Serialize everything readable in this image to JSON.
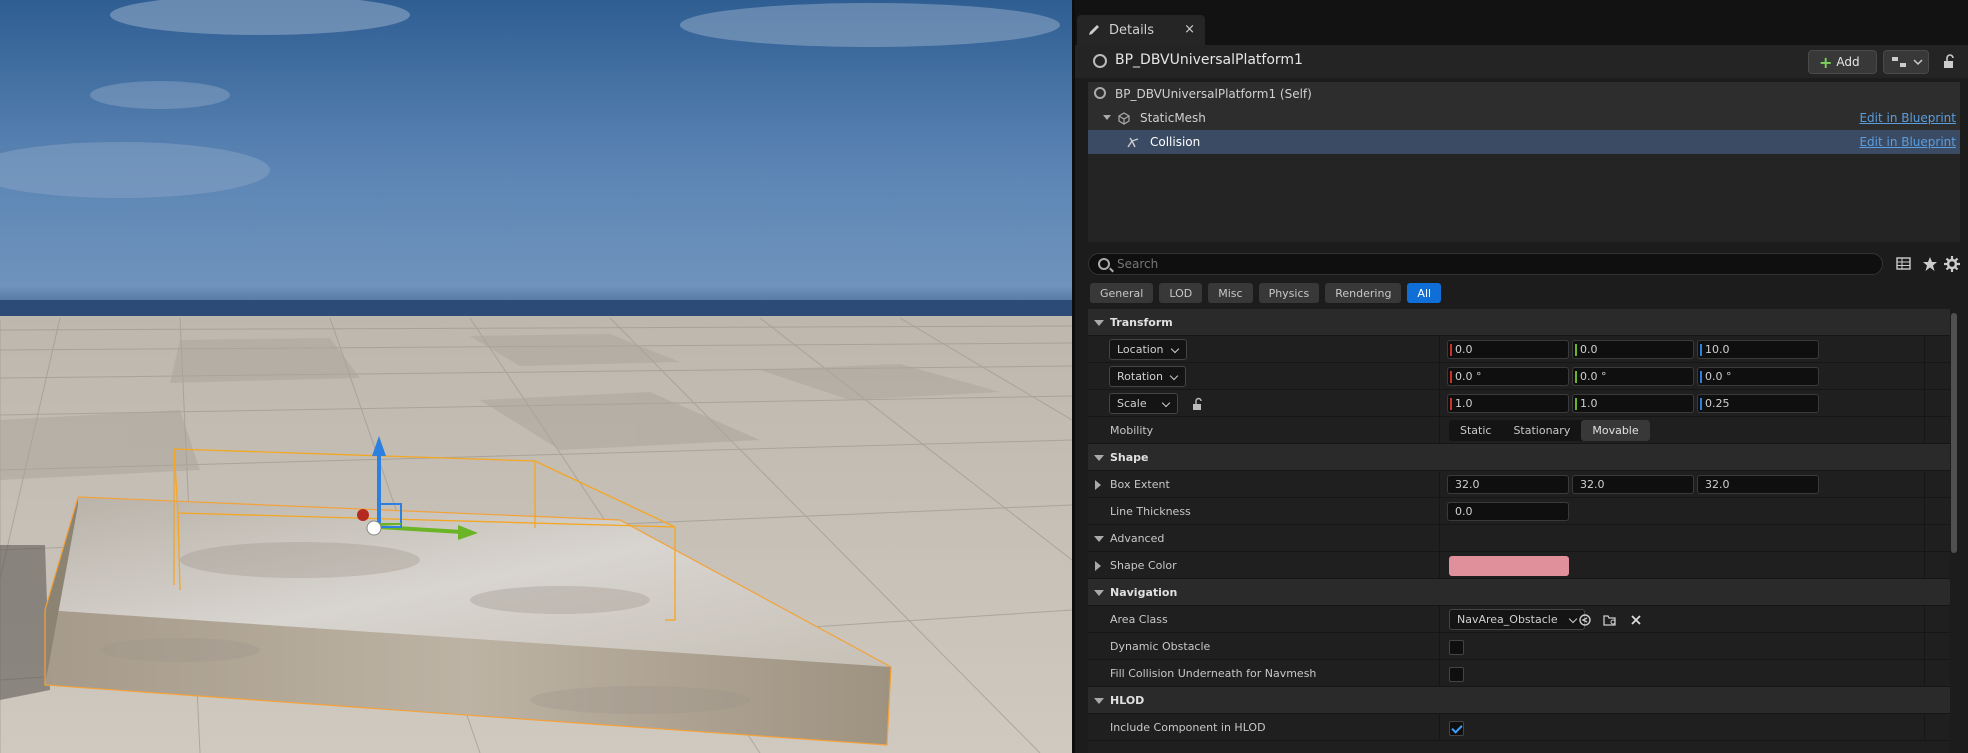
{
  "details_tab": {
    "label": "Details",
    "close": "×"
  },
  "header": {
    "actor_name": "BP_DBVUniversalPlatform1",
    "add_label": "Add"
  },
  "tree": [
    {
      "label": "BP_DBVUniversalPlatform1 (Self)",
      "link": ""
    },
    {
      "label": "StaticMesh",
      "link": "Edit in Blueprint"
    },
    {
      "label": "Collision",
      "link": "Edit in Blueprint"
    }
  ],
  "search": {
    "placeholder": "Search"
  },
  "filters": [
    "General",
    "LOD",
    "Misc",
    "Physics",
    "Rendering",
    "All"
  ],
  "active_filter": "All",
  "transform": {
    "category": "Transform",
    "location": {
      "label": "Location",
      "x": "0.0",
      "y": "0.0",
      "z": "10.0"
    },
    "rotation": {
      "label": "Rotation",
      "x": "0.0 °",
      "y": "0.0 °",
      "z": "0.0 °"
    },
    "scale": {
      "label": "Scale",
      "x": "1.0",
      "y": "1.0",
      "z": "0.25"
    },
    "mobility": {
      "label": "Mobility",
      "options": [
        "Static",
        "Stationary",
        "Movable"
      ],
      "selected": "Movable"
    }
  },
  "shape": {
    "category": "Shape",
    "box_extent": {
      "label": "Box Extent",
      "x": "32.0",
      "y": "32.0",
      "z": "32.0"
    },
    "line_thickness": {
      "label": "Line Thickness",
      "value": "0.0"
    },
    "advanced": "Advanced",
    "shape_color": {
      "label": "Shape Color",
      "color": "#e0909b"
    }
  },
  "navigation": {
    "category": "Navigation",
    "area_class": {
      "label": "Area Class",
      "value": "NavArea_Obstacle"
    },
    "dynamic_obstacle": {
      "label": "Dynamic Obstacle",
      "checked": false
    },
    "fill_collision": {
      "label": "Fill Collision Underneath for Navmesh",
      "checked": false
    }
  },
  "hlod": {
    "category": "HLOD",
    "include_component": {
      "label": "Include Component in HLOD",
      "checked": true
    }
  },
  "colors": {
    "accent": "#0f6fd6",
    "link": "#5a9ee0",
    "axis_x": "#c8342a",
    "axis_y": "#6ab425",
    "axis_z": "#2d7fe0"
  }
}
